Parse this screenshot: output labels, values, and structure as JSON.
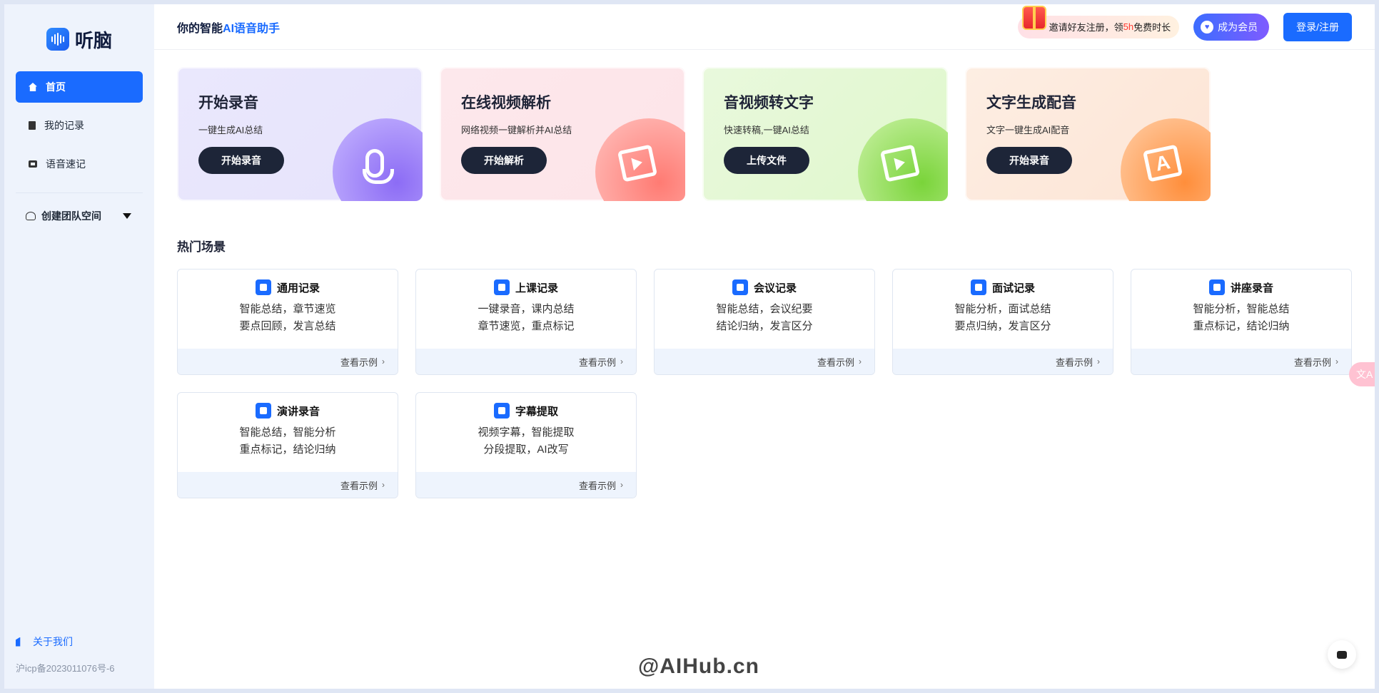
{
  "brand": {
    "name": "听脑"
  },
  "sidebar": {
    "items": [
      {
        "label": "首页",
        "icon": "home-icon"
      },
      {
        "label": "我的记录",
        "icon": "document-icon"
      },
      {
        "label": "语音速记",
        "icon": "record-icon"
      }
    ],
    "team_label": "创建团队空间",
    "about_label": "关于我们",
    "icp": "沪icp备2023011076号-6"
  },
  "header": {
    "tagline_prefix": "你的智能",
    "tagline_highlight": "AI语音助手",
    "invite_prefix": "邀请好友注册，领",
    "invite_highlight": "5h",
    "invite_suffix": "免费时长",
    "vip_label": "成为会员",
    "login_label": "登录/注册"
  },
  "features": [
    {
      "title": "开始录音",
      "desc": "一键生成AI总结",
      "button": "开始录音"
    },
    {
      "title": "在线视频解析",
      "desc": "网络视频一键解析并AI总结",
      "button": "开始解析"
    },
    {
      "title": "音视频转文字",
      "desc": "快速转稿,一键AI总结",
      "button": "上传文件"
    },
    {
      "title": "文字生成配音",
      "desc": "文字一键生成AI配音",
      "button": "开始录音"
    }
  ],
  "scenes_title": "热门场景",
  "scenes": [
    {
      "title": "通用记录",
      "line1": "智能总结，章节速览",
      "line2": "要点回顾，发言总结",
      "link": "查看示例"
    },
    {
      "title": "上课记录",
      "line1": "一键录音，课内总结",
      "line2": "章节速览，重点标记",
      "link": "查看示例"
    },
    {
      "title": "会议记录",
      "line1": "智能总结，会议纪要",
      "line2": "结论归纳，发言区分",
      "link": "查看示例"
    },
    {
      "title": "面试记录",
      "line1": "智能分析，面试总结",
      "line2": "要点归纳，发言区分",
      "link": "查看示例"
    },
    {
      "title": "讲座录音",
      "line1": "智能分析，智能总结",
      "line2": "重点标记，结论归纳",
      "link": "查看示例"
    },
    {
      "title": "演讲录音",
      "line1": "智能总结，智能分析",
      "line2": "重点标记，结论归纳",
      "link": "查看示例"
    },
    {
      "title": "字幕提取",
      "line1": "视频字幕，智能提取",
      "line2": "分段提取，AI改写",
      "link": "查看示例"
    }
  ],
  "watermark": "@AIHub.cn",
  "side_tab": "文A",
  "colors": {
    "primary": "#1a6bff",
    "dark_button": "#1d2538",
    "sidebar_bg": "#eef3fc"
  }
}
